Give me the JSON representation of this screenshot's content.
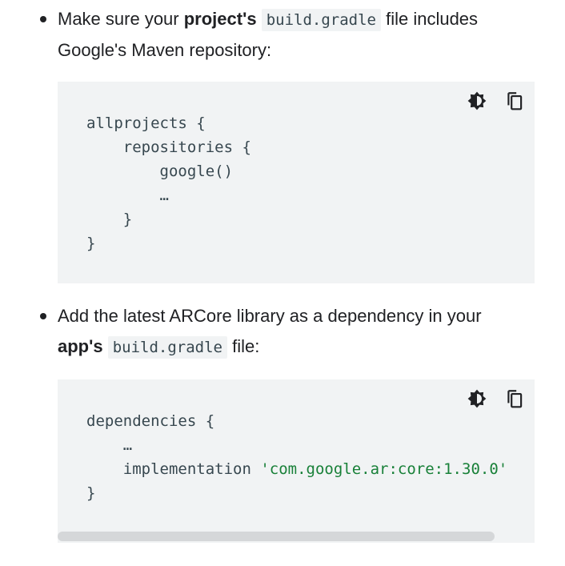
{
  "step1": {
    "text_before": "Make sure your ",
    "bold": "project's",
    "code": "build.gradle",
    "text_after_line1": " file includes",
    "text_line2": "Google's Maven repository:"
  },
  "code_block_1": {
    "lines": [
      "allprojects {",
      "    repositories {",
      "        google()",
      "        …",
      "    }",
      "}"
    ],
    "icons": [
      "dark-mode-toggle-icon",
      "copy-icon"
    ]
  },
  "step2": {
    "text_line1": "Add the latest ARCore library as a dependency in your",
    "bold": "app's",
    "code": "build.gradle",
    "text_after": " file:"
  },
  "code_block_2": {
    "lines": [
      "dependencies {",
      "    …",
      "    implementation ",
      "}"
    ],
    "string_literal": "'com.google.ar:core:1.30.0'",
    "icons": [
      "dark-mode-toggle-icon",
      "copy-icon"
    ],
    "scroll_position": 0
  },
  "colors": {
    "text": "#202124",
    "code_bg": "#f1f3f4",
    "code_text": "#37474f",
    "string": "#188038",
    "scrollbar_thumb": "#d5d7d9"
  }
}
